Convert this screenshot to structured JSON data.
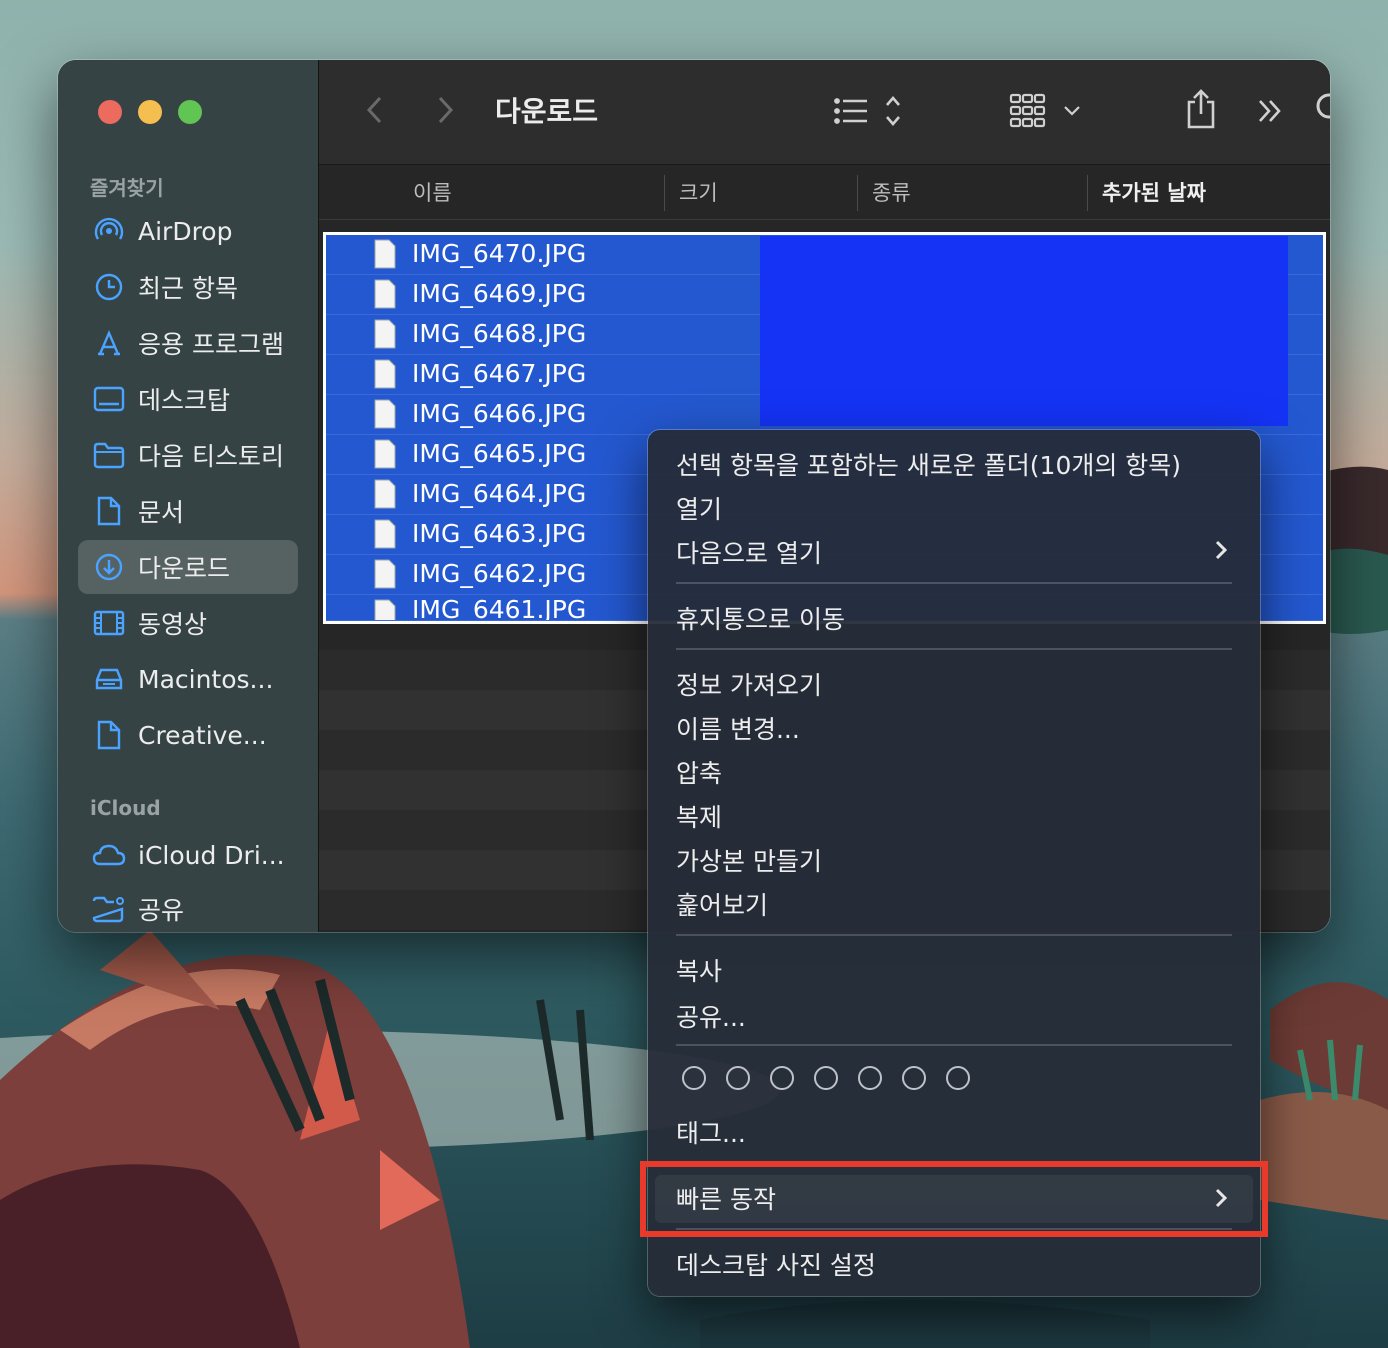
{
  "window": {
    "title": "다운로드"
  },
  "sidebar": {
    "favorites_header": "즐겨찾기",
    "favorites": [
      {
        "label": "AirDrop",
        "icon": "airdrop-icon"
      },
      {
        "label": "최근 항목",
        "icon": "clock-icon"
      },
      {
        "label": "응용 프로그램",
        "icon": "applications-icon"
      },
      {
        "label": "데스크탑",
        "icon": "desktop-icon"
      },
      {
        "label": "다음 티스토리",
        "icon": "folder-icon"
      },
      {
        "label": "문서",
        "icon": "document-icon"
      },
      {
        "label": "다운로드",
        "icon": "download-icon",
        "active": true
      },
      {
        "label": "동영상",
        "icon": "film-icon"
      },
      {
        "label": "Macintos...",
        "icon": "disk-icon"
      },
      {
        "label": "Creative...",
        "icon": "file-icon"
      }
    ],
    "icloud_header": "iCloud",
    "icloud": [
      {
        "label": "iCloud Dri...",
        "icon": "cloud-icon"
      },
      {
        "label": "공유",
        "icon": "shared-folder-icon"
      }
    ]
  },
  "columns": {
    "name": "이름",
    "size": "크기",
    "kind": "종류",
    "date_added": "추가된 날짜"
  },
  "files": [
    "IMG_6470.JPG",
    "IMG_6469.JPG",
    "IMG_6468.JPG",
    "IMG_6467.JPG",
    "IMG_6466.JPG",
    "IMG_6465.JPG",
    "IMG_6464.JPG",
    "IMG_6463.JPG",
    "IMG_6462.JPG",
    "IMG_6461.JPG"
  ],
  "context_menu": {
    "new_folder": "선택 항목을 포함하는 새로운 폴더(10개의 항목)",
    "open": "열기",
    "open_with": "다음으로 열기",
    "move_to_trash": "휴지통으로 이동",
    "get_info": "정보 가져오기",
    "rename": "이름 변경...",
    "compress": "압축",
    "duplicate": "복제",
    "make_alias": "가상본 만들기",
    "quick_look": "훑어보기",
    "copy": "복사",
    "share": "공유...",
    "tags": "태그...",
    "quick_actions": "빠른 동작",
    "set_desktop_picture": "데스크탑 사진 설정"
  },
  "colors": {
    "selection": "#2458d0",
    "highlight_box": "#e8392a"
  }
}
